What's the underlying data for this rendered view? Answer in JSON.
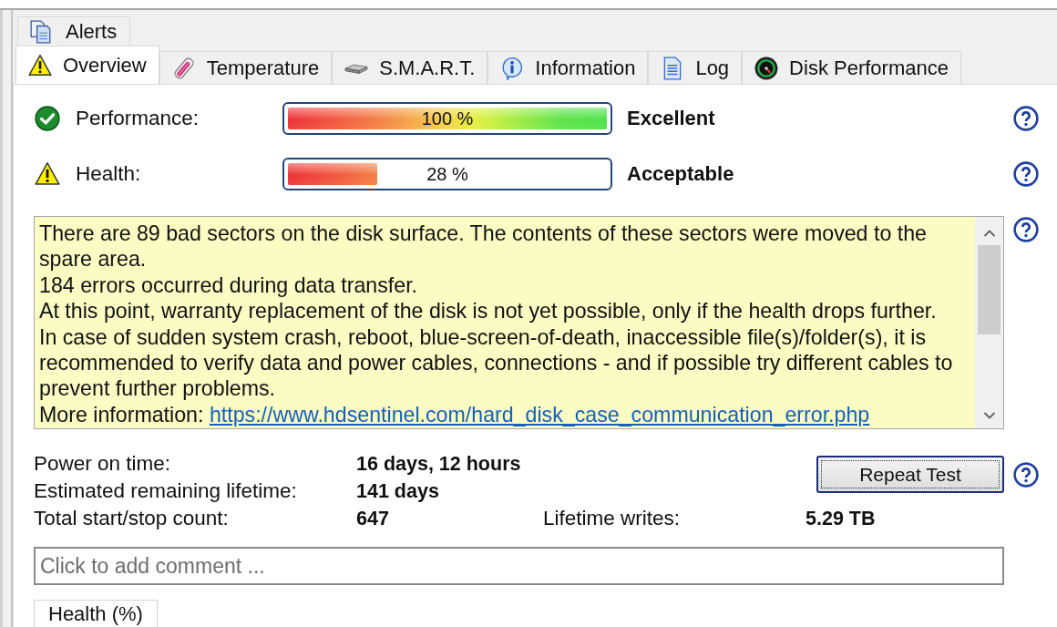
{
  "upper_tabs": [
    {
      "label": "Alerts",
      "selected": false
    }
  ],
  "tabs": [
    {
      "label": "Overview",
      "selected": true
    },
    {
      "label": "Temperature",
      "selected": false
    },
    {
      "label": "S.M.A.R.T.",
      "selected": false
    },
    {
      "label": "Information",
      "selected": false
    },
    {
      "label": "Log",
      "selected": false
    },
    {
      "label": "Disk Performance",
      "selected": false
    }
  ],
  "meters": [
    {
      "warning": false,
      "label": "Performance:",
      "level": 1,
      "reading": "100 %",
      "rating": "Excellent"
    },
    {
      "warning": true,
      "label": "Health:",
      "level": 0.28,
      "reading": "28 %",
      "rating": "Acceptable"
    }
  ],
  "message_box": {
    "paragraphs": [
      "There are 89 bad sectors on the disk surface. The contents of these sectors were moved to the spare area.",
      "184 errors occurred during data transfer.",
      "At this point, warranty replacement of the disk is not yet possible, only if the health drops further.",
      "In case of sudden system crash, reboot, blue-screen-of-death, inaccessible file(s)/folder(s), it is recommended to verify data and power cables, connections - and if possible try different cables to prevent further problems."
    ],
    "more_info_label": "More information:",
    "more_info_link": "https://www.hdsentinel.com/hard_disk_case_communication_error.php"
  },
  "stats": [
    {
      "label": "Power on time:",
      "value": "16 days, 12 hours"
    },
    {
      "label": "Estimated remaining lifetime:",
      "value": "141 days"
    },
    {
      "label": "Total start/stop count:",
      "value": "647"
    },
    {
      "label": "Lifetime writes:",
      "value": "5.29 TB"
    }
  ],
  "repeat_button": {
    "label": "Repeat Test",
    "focused": true
  },
  "comment": {
    "placeholder": "Click to add comment ..."
  },
  "bottom_tabs": [
    {
      "label": "Health (%)",
      "selected": true
    }
  ]
}
